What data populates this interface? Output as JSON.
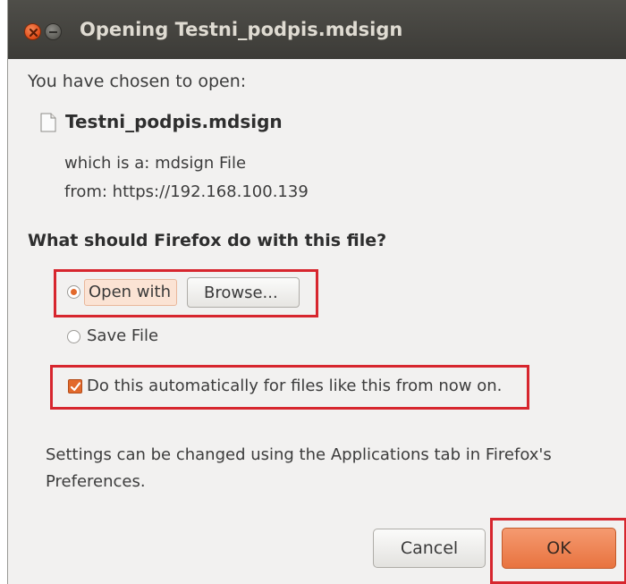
{
  "window": {
    "title": "Opening Testni_podpis.mdsign"
  },
  "dialog": {
    "chosen_text": "You have chosen to open:",
    "file_name": "Testni_podpis.mdsign",
    "file_type_line": "which is a:  mdsign File",
    "from_line": "from:  https://192.168.100.139",
    "question": "What should Firefox do with this file?",
    "open_with_label": "Open with",
    "browse_label": "Browse...",
    "save_file_label": "Save File",
    "auto_label": "Do this automatically for files like this from now on.",
    "settings_line1": "Settings can be changed using the Applications tab in Firefox's",
    "settings_line2": "Preferences.",
    "open_with_selected": true,
    "save_file_selected": false,
    "auto_checked": true
  },
  "buttons": {
    "cancel_label": "Cancel",
    "ok_label": "OK"
  },
  "colors": {
    "accent": "#e2692c",
    "highlight_box": "#d7262e",
    "titlebar": "#3c3b37",
    "dialog_bg": "#f2f1f0"
  },
  "icons": {
    "close": "close-icon",
    "minimize": "minimize-icon",
    "file": "file-icon",
    "check": "checkmark-icon"
  }
}
